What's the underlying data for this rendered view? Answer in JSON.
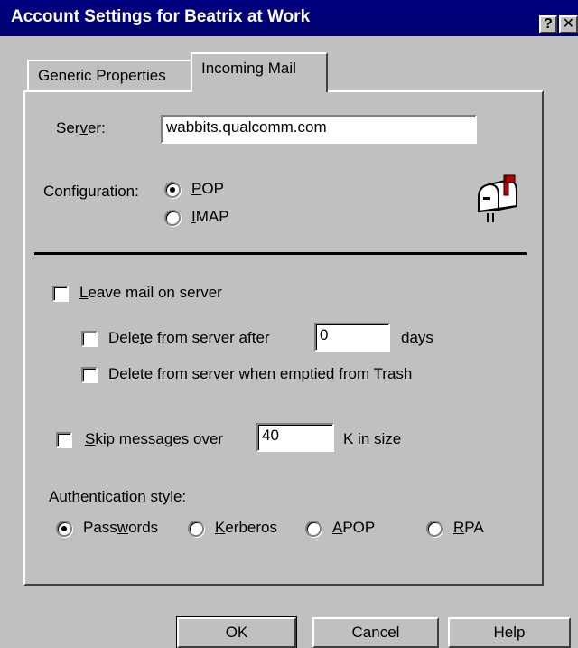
{
  "window": {
    "title": "Account Settings for Beatrix at Work",
    "help_glyph": "?",
    "close_glyph": "✕"
  },
  "tabs": [
    {
      "label": "Generic Properties",
      "active": false
    },
    {
      "label": "Incoming Mail",
      "active": true
    }
  ],
  "server": {
    "label_pre": "Ser",
    "label_key": "v",
    "label_post": "er:",
    "value": "wabbits.qualcomm.com"
  },
  "configuration": {
    "label": "Configuration:",
    "options": [
      {
        "key": "P",
        "rest": "OP",
        "selected": true
      },
      {
        "key": "I",
        "rest": "MAP",
        "selected": false
      }
    ]
  },
  "leave_mail": {
    "key": "L",
    "rest": "eave mail on server",
    "checked": false
  },
  "delete_after": {
    "pre": "Dele",
    "key": "t",
    "post": "e from server after",
    "value": "0",
    "unit": "days",
    "checked": false
  },
  "delete_trash": {
    "key": "D",
    "rest": "elete from server when emptied from Trash",
    "checked": false
  },
  "skip_messages": {
    "key": "S",
    "rest": "kip messages over",
    "value": "40",
    "unit": "K in size",
    "checked": false
  },
  "authentication": {
    "label": "Authentication style:",
    "options": [
      {
        "pre": "Pass",
        "key": "w",
        "post": "ords",
        "selected": true
      },
      {
        "pre": "",
        "key": "K",
        "post": "erberos",
        "selected": false
      },
      {
        "pre": "",
        "key": "A",
        "post": "POP",
        "selected": false
      },
      {
        "pre": "",
        "key": "R",
        "post": "PA",
        "selected": false
      }
    ]
  },
  "buttons": {
    "ok": "OK",
    "cancel": "Cancel",
    "help": "Help"
  },
  "icons": {
    "mailbox": "mailbox-icon"
  }
}
